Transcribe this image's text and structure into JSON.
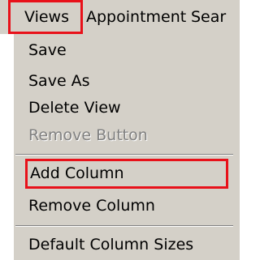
{
  "menubar": {
    "views_label": "Views",
    "appointment_label": "Appointment",
    "search_label": "Sear"
  },
  "views_menu": {
    "items": [
      {
        "label": "Save",
        "enabled": true
      },
      {
        "label": "Save As",
        "enabled": true
      },
      {
        "label": "Delete View",
        "enabled": true
      },
      {
        "label": "Remove Button",
        "enabled": false
      },
      {
        "label": "Add Column",
        "enabled": true,
        "highlighted": true
      },
      {
        "label": "Remove Column",
        "enabled": true
      },
      {
        "label": "Default Column Sizes",
        "enabled": true
      }
    ]
  },
  "colors": {
    "menu_background": "#d4d0c8",
    "highlight_outline": "#e8111a",
    "disabled_text": "#808080"
  }
}
